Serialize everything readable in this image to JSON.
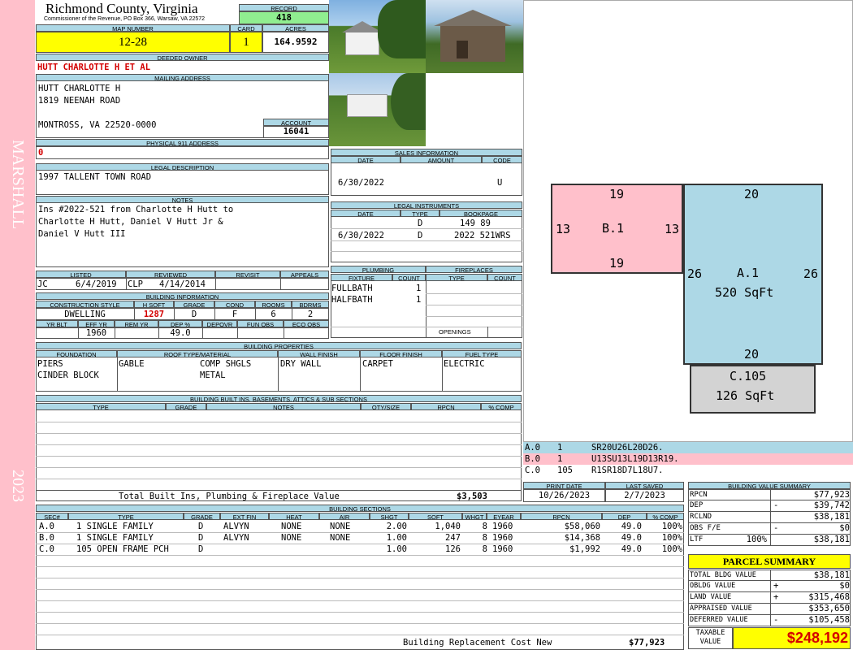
{
  "sidebar": {
    "name": "MARSHALL",
    "year": "2023"
  },
  "header": {
    "county": "Richmond County, Virginia",
    "commissioner": "Commissioner of the Revenue, PO Box 366, Warsaw, VA 22572",
    "record_label": "RECORD",
    "record": "418",
    "map_label": "MAP NUMBER",
    "map": "12-28",
    "card_label": "CARD",
    "card": "1",
    "acres_label": "ACRES",
    "acres": "164.9592"
  },
  "owner": {
    "deeded_label": "DEEDED OWNER",
    "deeded": "HUTT CHARLOTTE H ET AL",
    "mailing_label": "MAILING ADDRESS",
    "mail1": "HUTT CHARLOTTE H",
    "mail2": "1819 NEENAH ROAD",
    "mail3": "MONTROSS, VA 22520-0000",
    "account_label": "ACCOUNT",
    "account": "16041",
    "p911_label": "PHYSICAL 911 ADDRESS",
    "p911": "0"
  },
  "legal": {
    "label": "LEGAL DESCRIPTION",
    "text": "1997 TALLENT TOWN ROAD"
  },
  "notes": {
    "label": "NOTES",
    "line1": "Ins #2022-521 from Charlotte H Hutt to",
    "line2": "Charlotte H Hutt, Daniel V Hutt Jr &",
    "line3": "Daniel V Hutt III"
  },
  "listed": {
    "listed_label": "LISTED",
    "reviewed_label": "REVIEWED",
    "revisit_label": "REVISIT",
    "appeals_label": "APPEALS",
    "listed_by": "JC",
    "listed_date": "6/4/2019",
    "reviewed_by": "CLP",
    "reviewed_date": "4/14/2014"
  },
  "building_info": {
    "label": "BUILDING INFORMATION",
    "h_style": "CONSTRUCTION STYLE",
    "h_hsqft": "H SQFT",
    "h_grade": "GRADE",
    "h_cond": "COND",
    "h_rooms": "ROOMS",
    "h_bdrms": "BDRMS",
    "style": "DWELLING",
    "hsqft": "1287",
    "grade": "D",
    "cond": "F",
    "rooms": "6",
    "bdrms": "2",
    "h_yrblt": "YR BLT",
    "h_effyr": "EFF YR",
    "h_remyr": "REM YR",
    "h_dep": "DEP %",
    "h_depovr": "DEPOVR",
    "h_funobs": "FUN OBS",
    "h_ecoobs": "ECO OBS",
    "effyr": "1960",
    "dep": "49.0"
  },
  "sales": {
    "label": "SALES INFORMATION",
    "h_date": "DATE",
    "h_amount": "AMOUNT",
    "h_code": "CODE",
    "date": "6/30/2022",
    "code": "U"
  },
  "instruments": {
    "label": "LEGAL INSTRUMENTS",
    "h_date": "DATE",
    "h_type": "TYPE",
    "h_book": "BOOKPAGE",
    "rows": [
      {
        "date": "",
        "type": "D",
        "book": "149 89"
      },
      {
        "date": "6/30/2022",
        "type": "D",
        "book": "2022 521WRS"
      }
    ]
  },
  "plumbing": {
    "label": "PLUMBING",
    "h_fixture": "FIXTURE",
    "h_count": "COUNT",
    "rows": [
      {
        "fixture": "FULLBATH",
        "count": "1"
      },
      {
        "fixture": "HALFBATH",
        "count": "1"
      }
    ]
  },
  "fireplaces": {
    "label": "FIREPLACES",
    "h_type": "TYPE",
    "h_count": "COUNT",
    "openings": "OPENINGS"
  },
  "properties": {
    "label": "BUILDING PROPERTIES",
    "h_foundation": "FOUNDATION",
    "h_roof": "ROOF TYPE/MATERIAL",
    "h_wall": "WALL FINISH",
    "h_floor": "FLOOR FINISH",
    "h_fuel": "FUEL TYPE",
    "foundation1": "PIERS",
    "foundation2": "CINDER BLOCK",
    "roof_type": "GABLE",
    "roof_mat1": "COMP SHGLS",
    "roof_mat2": "METAL",
    "wall": "DRY WALL",
    "floor": "CARPET",
    "fuel": "ELECTRIC"
  },
  "builtins": {
    "label": "BUILDING BUILT INS, BASEMENTS, ATTICS & SUB SECTIONS",
    "h_type": "TYPE",
    "h_grade": "GRADE",
    "h_notes": "NOTES",
    "h_qty": "QTY/SIZE",
    "h_rpcn": "RPCN",
    "h_comp": "% COMP",
    "total_label": "Total Built Ins, Plumbing & Fireplace Value",
    "total": "$3,503"
  },
  "dates": {
    "print_label": "PRINT DATE",
    "saved_label": "LAST SAVED",
    "print": "10/26/2023",
    "saved": "2/7/2023"
  },
  "sketch": {
    "b_top": "19",
    "b_bottom": "19",
    "b_left": "13",
    "b_right": "13",
    "b_label": "B.1",
    "a_top": "20",
    "a_bottom": "20",
    "a_left": "26",
    "a_right": "26",
    "a_label": "A.1",
    "a_area": "520 SqFt",
    "c_label": "C.105",
    "c_area": "126 SqFt"
  },
  "sketch_codes": [
    {
      "sec": "A.0",
      "num": "1",
      "code": "SR20U26L20D26.",
      "color": "#add8e6"
    },
    {
      "sec": "B.0",
      "num": "1",
      "code": "U13SU13L19D13R19.",
      "color": "#ffc0cb"
    },
    {
      "sec": "C.0",
      "num": "105",
      "code": "R1SR18D7L18U7.",
      "color": "#ffffff"
    }
  ],
  "sections": {
    "label": "BUILDING SECTIONS",
    "h_sec": "SEC#",
    "h_type": "TYPE",
    "h_grade": "GRADE",
    "h_extfin": "EXT FIN",
    "h_heat": "HEAT",
    "h_air": "AIR",
    "h_shgt": "SHGT",
    "h_sqft": "SQFT",
    "h_whgt": "WHGT",
    "h_eyear": "EYEAR",
    "h_rpcn": "RPCN",
    "h_dep": "DEP",
    "h_comp": "% COMP",
    "rows": [
      {
        "sec": "A.0",
        "type": "1 SINGLE FAMILY",
        "grade": "D",
        "extfin": "ALVYN",
        "heat": "NONE",
        "air": "NONE",
        "shgt": "2.00",
        "sqft": "1,040",
        "whgt": "8",
        "eyear": "1960",
        "rpcn": "$58,060",
        "dep": "49.0",
        "comp": "100%"
      },
      {
        "sec": "B.0",
        "type": "1 SINGLE FAMILY",
        "grade": "D",
        "extfin": "ALVYN",
        "heat": "NONE",
        "air": "NONE",
        "shgt": "1.00",
        "sqft": "247",
        "whgt": "8",
        "eyear": "1960",
        "rpcn": "$14,368",
        "dep": "49.0",
        "comp": "100%"
      },
      {
        "sec": "C.0",
        "type": "105 OPEN FRAME PCH",
        "grade": "D",
        "extfin": "",
        "heat": "",
        "air": "",
        "shgt": "1.00",
        "sqft": "126",
        "whgt": "8",
        "eyear": "1960",
        "rpcn": "$1,992",
        "dep": "49.0",
        "comp": "100%"
      }
    ],
    "rcn_label": "Building Replacement Cost New",
    "rcn": "$77,923"
  },
  "value_summary": {
    "label": "BUILDING VALUE SUMMARY",
    "rows": [
      {
        "label": "RPCN",
        "pre": "",
        "sign": "",
        "value": "$77,923"
      },
      {
        "label": "DEP",
        "pre": "",
        "sign": "-",
        "value": "$39,742"
      },
      {
        "label": "RCLND",
        "pre": "",
        "sign": "",
        "value": "$38,181"
      },
      {
        "label": "OBS F/E",
        "pre": "",
        "sign": "-",
        "value": "$0"
      },
      {
        "label": "LTF",
        "pre": "100%",
        "sign": "",
        "value": "$38,181"
      }
    ]
  },
  "parcel": {
    "label": "PARCEL SUMMARY",
    "rows": [
      {
        "label": "TOTAL BLDG VALUE",
        "sign": "",
        "value": "$38,181"
      },
      {
        "label": "OBLDG VALUE",
        "sign": "+",
        "value": "$0"
      },
      {
        "label": "LAND VALUE",
        "sign": "+",
        "value": "$315,468"
      },
      {
        "label": "APPRAISED VALUE",
        "sign": "",
        "value": "$353,650"
      },
      {
        "label": "DEFERRED VALUE",
        "sign": "-",
        "value": "$105,458"
      }
    ],
    "taxable_label1": "TAXABLE",
    "taxable_label2": "VALUE",
    "taxable": "$248,192"
  }
}
